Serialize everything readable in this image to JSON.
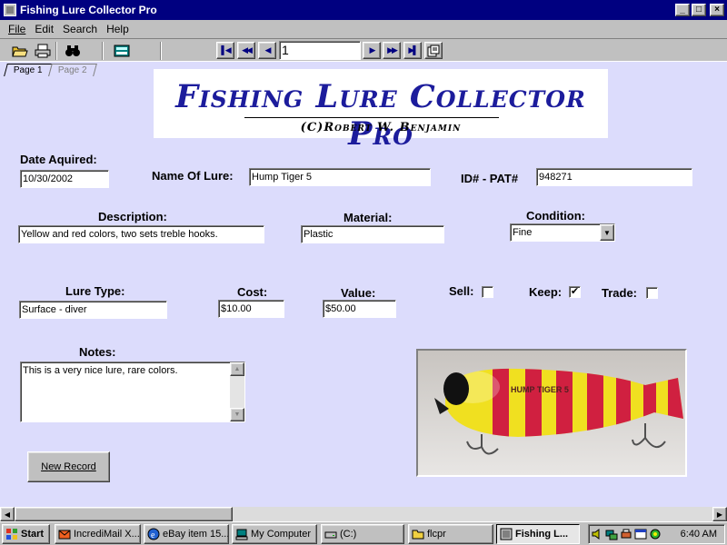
{
  "window": {
    "title": "Fishing Lure Collector Pro"
  },
  "menu": [
    "File",
    "Edit",
    "Search",
    "Help"
  ],
  "navigator": {
    "record_number": "1"
  },
  "tabs": [
    "Page 1",
    "Page 2"
  ],
  "banner": {
    "title": "Fishing Lure Collector Pro",
    "subtitle": "(C)Robert W. Benjamin"
  },
  "form": {
    "date_label": "Date Aquired:",
    "date_value": "10/30/2002",
    "name_label": "Name Of Lure:",
    "name_value": "Hump Tiger 5",
    "id_label": "ID# - PAT#",
    "id_value": "948271",
    "description_label": "Description:",
    "description_value": "Yellow and red colors, two sets treble hooks.",
    "material_label": "Material:",
    "material_value": "Plastic",
    "condition_label": "Condition:",
    "condition_value": "Fine",
    "lure_type_label": "Lure Type:",
    "lure_type_value": "Surface - diver",
    "cost_label": "Cost:",
    "cost_value": "$10.00",
    "value_label": "Value:",
    "value_value": "$50.00",
    "sell_label": "Sell:",
    "sell_checked": false,
    "keep_label": "Keep:",
    "keep_checked": true,
    "trade_label": "Trade:",
    "trade_checked": false,
    "notes_label": "Notes:",
    "notes_value": "This is a very nice lure, rare colors.",
    "new_record_label": "New Record"
  },
  "photo": {
    "lure_text": "HUMP TIGER 5"
  },
  "taskbar": {
    "start_label": "Start",
    "tasks": [
      "IncrediMail X...",
      "eBay item 15...",
      "My Computer",
      "(C:)",
      "flcpr",
      "Fishing L..."
    ],
    "clock": "6:40 AM"
  },
  "colors": {
    "title_bar": "#000080",
    "form_background": "#dcdcfc",
    "banner_text": "#1c1c9c"
  }
}
